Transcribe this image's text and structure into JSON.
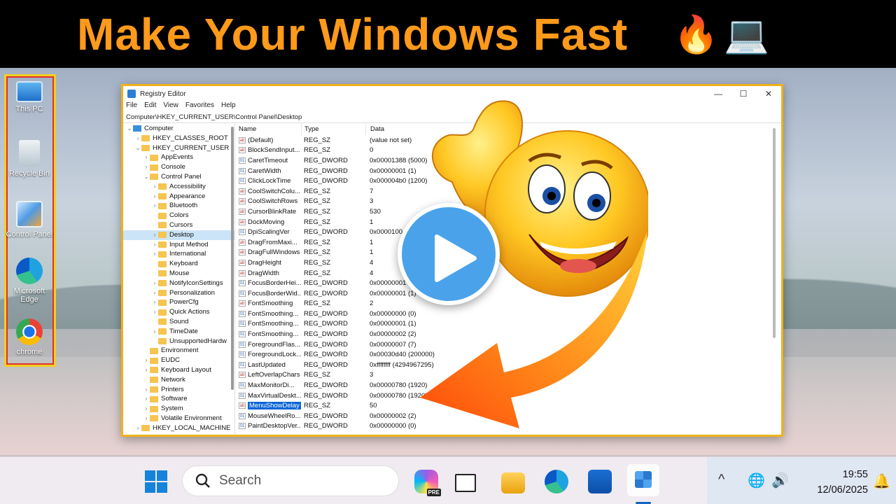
{
  "banner": {
    "title": "Make Your Windows Fast",
    "emoji_1": "🔥",
    "emoji_2": "💻"
  },
  "desktop_icons": [
    {
      "label": "This PC",
      "icon": "monitor-icon"
    },
    {
      "label": "Recycle Bin",
      "icon": "recycle-bin-icon"
    },
    {
      "label": "Control Panel",
      "icon": "control-panel-icon"
    },
    {
      "label": "Microsoft Edge",
      "icon": "edge-icon"
    },
    {
      "label": "chrome",
      "icon": "chrome-icon"
    }
  ],
  "regedit": {
    "title": "Registry Editor",
    "controls": {
      "minimize": "—",
      "maximize": "☐",
      "close": "✕"
    },
    "menu": [
      "File",
      "Edit",
      "View",
      "Favorites",
      "Help"
    ],
    "address": "Computer\\HKEY_CURRENT_USER\\Control Panel\\Desktop",
    "tree": [
      {
        "label": "Computer",
        "arrow": "⌄"
      },
      {
        "label": "HKEY_CLASSES_ROOT",
        "arrow": "›"
      },
      {
        "label": "HKEY_CURRENT_USER",
        "arrow": "⌄"
      },
      {
        "label": "AppEvents",
        "arrow": "›"
      },
      {
        "label": "Console",
        "arrow": "›"
      },
      {
        "label": "Control Panel",
        "arrow": "⌄"
      },
      {
        "label": "Accessibility",
        "arrow": "›"
      },
      {
        "label": "Appearance",
        "arrow": "›"
      },
      {
        "label": "Bluetooth",
        "arrow": "›"
      },
      {
        "label": "Colors",
        "arrow": ""
      },
      {
        "label": "Cursors",
        "arrow": ""
      },
      {
        "label": "Desktop",
        "arrow": "›"
      },
      {
        "label": "Input Method",
        "arrow": "›"
      },
      {
        "label": "International",
        "arrow": "›"
      },
      {
        "label": "Keyboard",
        "arrow": ""
      },
      {
        "label": "Mouse",
        "arrow": ""
      },
      {
        "label": "NotifyIconSettings",
        "arrow": "›"
      },
      {
        "label": "Personalization",
        "arrow": "›"
      },
      {
        "label": "PowerCfg",
        "arrow": "›"
      },
      {
        "label": "Quick Actions",
        "arrow": "›"
      },
      {
        "label": "Sound",
        "arrow": ""
      },
      {
        "label": "TimeDate",
        "arrow": "›"
      },
      {
        "label": "UnsupportedHardw",
        "arrow": ""
      },
      {
        "label": "Environment",
        "arrow": ""
      },
      {
        "label": "EUDC",
        "arrow": "›"
      },
      {
        "label": "Keyboard Layout",
        "arrow": "›"
      },
      {
        "label": "Network",
        "arrow": ""
      },
      {
        "label": "Printers",
        "arrow": "›"
      },
      {
        "label": "Software",
        "arrow": "›"
      },
      {
        "label": "System",
        "arrow": "›"
      },
      {
        "label": "Volatile Environment",
        "arrow": "›"
      },
      {
        "label": "HKEY_LOCAL_MACHINE",
        "arrow": "›"
      }
    ],
    "tree_selected": "Desktop",
    "columns": [
      "Name",
      "Type",
      "Data"
    ],
    "values": [
      {
        "name": "(Default)",
        "type": "REG_SZ",
        "data": "(value not set)"
      },
      {
        "name": "BlockSendInput...",
        "type": "REG_SZ",
        "data": "0"
      },
      {
        "name": "CaretTimeout",
        "type": "REG_DWORD",
        "data": "0x00001388 (5000)"
      },
      {
        "name": "CaretWidth",
        "type": "REG_DWORD",
        "data": "0x00000001 (1)"
      },
      {
        "name": "ClickLockTime",
        "type": "REG_DWORD",
        "data": "0x000004b0 (1200)"
      },
      {
        "name": "CoolSwitchColu...",
        "type": "REG_SZ",
        "data": "7"
      },
      {
        "name": "CoolSwitchRows",
        "type": "REG_SZ",
        "data": "3"
      },
      {
        "name": "CursorBlinkRate",
        "type": "REG_SZ",
        "data": "530"
      },
      {
        "name": "DockMoving",
        "type": "REG_SZ",
        "data": "1"
      },
      {
        "name": "DpiScalingVer",
        "type": "REG_DWORD",
        "data": "0x0000100"
      },
      {
        "name": "DragFromMaxi...",
        "type": "REG_SZ",
        "data": "1"
      },
      {
        "name": "DragFullWindows",
        "type": "REG_SZ",
        "data": "1"
      },
      {
        "name": "DragHeight",
        "type": "REG_SZ",
        "data": "4"
      },
      {
        "name": "DragWidth",
        "type": "REG_SZ",
        "data": "4"
      },
      {
        "name": "FocusBorderHei...",
        "type": "REG_DWORD",
        "data": "0x00000001 ("
      },
      {
        "name": "FocusBorderWid...",
        "type": "REG_DWORD",
        "data": "0x00000001 (1)"
      },
      {
        "name": "FontSmoothing",
        "type": "REG_SZ",
        "data": "2"
      },
      {
        "name": "FontSmoothing...",
        "type": "REG_DWORD",
        "data": "0x00000000 (0)"
      },
      {
        "name": "FontSmoothing...",
        "type": "REG_DWORD",
        "data": "0x00000001 (1)"
      },
      {
        "name": "FontSmoothing...",
        "type": "REG_DWORD",
        "data": "0x00000002 (2)"
      },
      {
        "name": "ForegroundFlas...",
        "type": "REG_DWORD",
        "data": "0x00000007 (7)"
      },
      {
        "name": "ForegroundLock...",
        "type": "REG_DWORD",
        "data": "0x00030d40 (200000)"
      },
      {
        "name": "LastUpdated",
        "type": "REG_DWORD",
        "data": "0xffffffff (4294967295)"
      },
      {
        "name": "LeftOverlapChars",
        "type": "REG_SZ",
        "data": "3"
      },
      {
        "name": "MaxMonitorDi...",
        "type": "REG_DWORD",
        "data": "0x00000780 (1920)"
      },
      {
        "name": "MaxVirtualDeskt...",
        "type": "REG_DWORD",
        "data": "0x00000780 (1920)"
      },
      {
        "name": "MenuShowDelay",
        "type": "REG_SZ",
        "data": "50"
      },
      {
        "name": "MouseWheelRo...",
        "type": "REG_DWORD",
        "data": "0x00000002 (2)"
      },
      {
        "name": "PaintDesktopVer...",
        "type": "REG_DWORD",
        "data": "0x00000000 (0)"
      }
    ],
    "selected_value": "MenuShowDelay"
  },
  "taskbar": {
    "search_placeholder": "Search",
    "copilot_badge": "PRE",
    "time": "19:55",
    "date": "12/06/2025",
    "tray": {
      "chevron": "^",
      "network": "🌐",
      "volume": "🔊",
      "bell": "🔔"
    }
  },
  "colors": {
    "banner_text": "#ff9a1a",
    "accent": "#0a64d6",
    "window_border": "#f0b21a",
    "icons_box": "#e03030"
  }
}
